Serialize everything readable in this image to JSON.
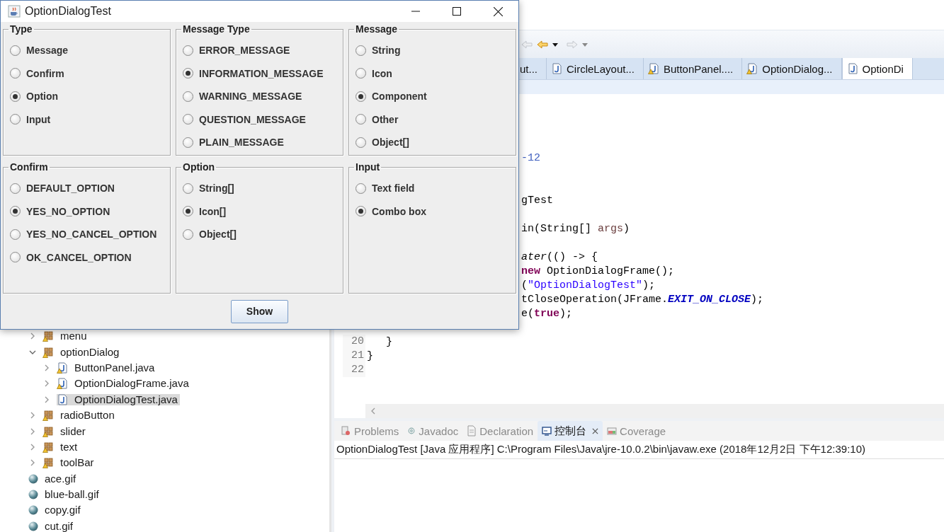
{
  "dialog": {
    "title": "OptionDialogTest",
    "groups": [
      {
        "title": "Type",
        "options": [
          {
            "label": "Message",
            "selected": false
          },
          {
            "label": "Confirm",
            "selected": false
          },
          {
            "label": "Option",
            "selected": true
          },
          {
            "label": "Input",
            "selected": false
          }
        ]
      },
      {
        "title": "Message Type",
        "options": [
          {
            "label": "ERROR_MESSAGE",
            "selected": false
          },
          {
            "label": "INFORMATION_MESSAGE",
            "selected": true
          },
          {
            "label": "WARNING_MESSAGE",
            "selected": false
          },
          {
            "label": "QUESTION_MESSAGE",
            "selected": false
          },
          {
            "label": "PLAIN_MESSAGE",
            "selected": false
          }
        ]
      },
      {
        "title": "Message",
        "options": [
          {
            "label": "String",
            "selected": false
          },
          {
            "label": "Icon",
            "selected": false
          },
          {
            "label": "Component",
            "selected": true
          },
          {
            "label": "Other",
            "selected": false
          },
          {
            "label": "Object[]",
            "selected": false
          }
        ]
      },
      {
        "title": "Confirm",
        "options": [
          {
            "label": "DEFAULT_OPTION",
            "selected": false
          },
          {
            "label": "YES_NO_OPTION",
            "selected": true
          },
          {
            "label": "YES_NO_CANCEL_OPTION",
            "selected": false
          },
          {
            "label": "OK_CANCEL_OPTION",
            "selected": false
          }
        ]
      },
      {
        "title": "Option",
        "options": [
          {
            "label": "String[]",
            "selected": false
          },
          {
            "label": "Icon[]",
            "selected": true
          },
          {
            "label": "Object[]",
            "selected": false
          }
        ]
      },
      {
        "title": "Input",
        "options": [
          {
            "label": "Text field",
            "selected": false
          },
          {
            "label": "Combo box",
            "selected": true
          }
        ]
      }
    ],
    "button": "Show"
  },
  "editor_tabs": [
    {
      "label": "ut...",
      "selected": false
    },
    {
      "label": "CircleLayout...",
      "warning": false,
      "selected": false
    },
    {
      "label": "ButtonPanel....",
      "warning": true,
      "selected": false
    },
    {
      "label": "OptionDialog...",
      "warning": true,
      "selected": false
    },
    {
      "label": "OptionDi",
      "warning": false,
      "selected": true
    }
  ],
  "editor": {
    "lines": [
      {
        "kind": "blank"
      },
      {
        "kind": "blank"
      },
      {
        "kind": "blank"
      },
      {
        "kind": "blank"
      },
      {
        "kind": "partial",
        "segments": [
          {
            "text": "-12",
            "kind": "javadoc"
          }
        ]
      },
      {
        "kind": "blank"
      },
      {
        "kind": "blank"
      },
      {
        "kind": "partial",
        "segments": [
          {
            "text": "gTest",
            "kind": "plain"
          }
        ]
      },
      {
        "kind": "blank"
      },
      {
        "kind": "partial",
        "segments": [
          {
            "text": "in(String[] ",
            "kind": "plain"
          },
          {
            "text": "args",
            "kind": "param"
          },
          {
            "text": ")",
            "kind": "plain"
          }
        ]
      },
      {
        "kind": "blank"
      },
      {
        "kind": "partial",
        "segments": [
          {
            "text": "ater",
            "kind": "italic"
          },
          {
            "text": "(() -> {",
            "kind": "plain"
          }
        ]
      },
      {
        "kind": "partial",
        "segments": [
          {
            "text": "new",
            "kind": "keyword"
          },
          {
            "text": " OptionDialogFrame();",
            "kind": "plain"
          }
        ]
      },
      {
        "kind": "partial",
        "segments": [
          {
            "text": "(",
            "kind": "plain"
          },
          {
            "text": "\"OptionDialogTest\"",
            "kind": "string"
          },
          {
            "text": ");",
            "kind": "plain"
          }
        ]
      },
      {
        "kind": "partial",
        "segments": [
          {
            "text": "tCloseOperation(JFrame.",
            "kind": "plain"
          },
          {
            "text": "EXIT_ON_CLOSE",
            "kind": "constant"
          },
          {
            "text": ");",
            "kind": "plain"
          }
        ]
      },
      {
        "kind": "partial",
        "segments": [
          {
            "text": "e(",
            "kind": "plain"
          },
          {
            "text": "true",
            "kind": "keyword"
          },
          {
            "text": ");",
            "kind": "plain"
          }
        ]
      },
      {
        "kind": "blank"
      },
      {
        "number": "20",
        "kind": "full",
        "segments": [
          {
            "text": "   }",
            "kind": "plain"
          }
        ]
      },
      {
        "number": "21",
        "kind": "full",
        "segments": [
          {
            "text": "}",
            "kind": "plain"
          }
        ]
      },
      {
        "number": "22",
        "kind": "full"
      }
    ]
  },
  "package_explorer": {
    "items": [
      {
        "label": "menu",
        "kind": "package",
        "expanded": false,
        "warning": true,
        "selected": false
      },
      {
        "label": "optionDialog",
        "kind": "package",
        "expanded": true,
        "warning": true,
        "selected": false,
        "children": [
          {
            "label": "ButtonPanel.java",
            "kind": "java",
            "expanded": false,
            "warning": true,
            "selected": false
          },
          {
            "label": "OptionDialogFrame.java",
            "kind": "java",
            "expanded": false,
            "warning": true,
            "selected": false
          },
          {
            "label": "OptionDialogTest.java",
            "kind": "java",
            "expanded": false,
            "warning": false,
            "selected": true
          }
        ]
      },
      {
        "label": "radioButton",
        "kind": "package",
        "expanded": false,
        "warning": true,
        "selected": false
      },
      {
        "label": "slider",
        "kind": "package",
        "expanded": false,
        "warning": true,
        "selected": false
      },
      {
        "label": "text",
        "kind": "package",
        "expanded": false,
        "warning": true,
        "selected": false
      },
      {
        "label": "toolBar",
        "kind": "package",
        "expanded": false,
        "warning": true,
        "selected": false
      },
      {
        "label": "ace.gif",
        "kind": "gif",
        "selected": false
      },
      {
        "label": "blue-ball.gif",
        "kind": "gif",
        "selected": false
      },
      {
        "label": "copy.gif",
        "kind": "gif",
        "selected": false
      },
      {
        "label": "cut.gif",
        "kind": "gif",
        "selected": false
      }
    ]
  },
  "views": {
    "tabs": [
      {
        "label": "Problems",
        "kind": "problems",
        "selected": false,
        "closable": false
      },
      {
        "label": "Javadoc",
        "kind": "javadoc",
        "selected": false,
        "closable": false
      },
      {
        "label": "Declaration",
        "kind": "declaration",
        "selected": false,
        "closable": false
      },
      {
        "label": "控制台",
        "kind": "console",
        "selected": true,
        "closable": true
      },
      {
        "label": "Coverage",
        "kind": "coverage",
        "selected": false,
        "closable": false
      }
    ],
    "console": "OptionDialogTest [Java 应用程序] C:\\Program Files\\Java\\jre-10.0.2\\bin\\javaw.exe  (2018年12月2日 下午12:39:10)"
  }
}
